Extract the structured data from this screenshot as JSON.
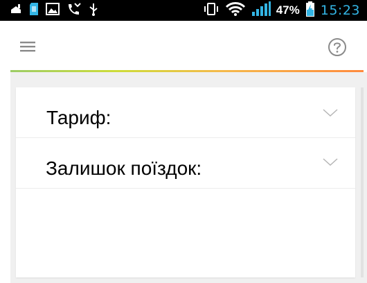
{
  "status_bar": {
    "icons_left": [
      "notification-icon",
      "sd-card-icon",
      "image-icon",
      "missed-call-icon",
      "usb-icon"
    ],
    "icons_right": [
      "vibrate-icon",
      "wifi-icon",
      "signal-icon",
      "battery-charging-icon"
    ],
    "battery_percent": "47%",
    "time": "15:23"
  },
  "app_bar": {
    "menu_icon": "hamburger-menu-icon",
    "help_icon": "help-circle-icon"
  },
  "colors": {
    "status_bar_bg": "#000000",
    "time": "#33b5e5",
    "accent_gradient_start": "#9ccc65",
    "accent_gradient_end": "#ff8a3d",
    "content_bg": "#f0f0f0"
  },
  "card": {
    "rows": [
      {
        "label": "Тариф:",
        "icon": "chevron-down-icon"
      },
      {
        "label": "Залишок поїздок:",
        "icon": "chevron-down-icon"
      }
    ]
  }
}
